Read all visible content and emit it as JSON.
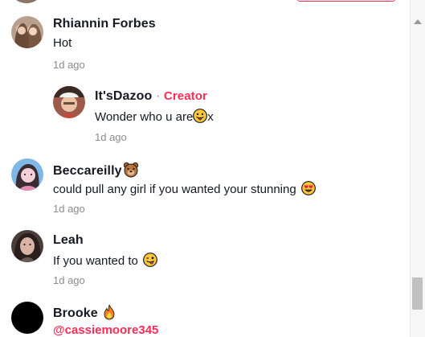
{
  "comments": [
    {
      "author": "Rhiannin Forbes",
      "text": "Hot",
      "time": "1d ago",
      "avatar_icon": "two-women-photo-avatar"
    },
    {
      "author": "It'sDazoo",
      "separator": "·",
      "badge": "Creator",
      "text": "Wonder who u are",
      "text_suffix": "x",
      "emoji": "tongue-out-emoji",
      "time": "1d ago",
      "avatar_icon": "man-cap-photo-avatar"
    },
    {
      "author": "Beccareilly",
      "author_emoji": "bear-face-emoji",
      "text": "could pull any girl if you wanted your stunning",
      "emoji": "heart-eyes-emoji",
      "time": "1d ago",
      "avatar_icon": "woman-pink-photo-avatar"
    },
    {
      "author": "Leah",
      "text": "If you wanted to",
      "emoji": "winking-tongue-emoji",
      "time": "1d ago",
      "avatar_icon": "woman-dark-hair-photo-avatar"
    },
    {
      "author": "Brooke",
      "author_emoji": "fire-emoji",
      "mention": "@cassiemoore345",
      "avatar_icon": "black-avatar"
    }
  ],
  "colors": {
    "accent": "#fe2c55",
    "text": "#161823",
    "muted": "#8a8b91"
  }
}
